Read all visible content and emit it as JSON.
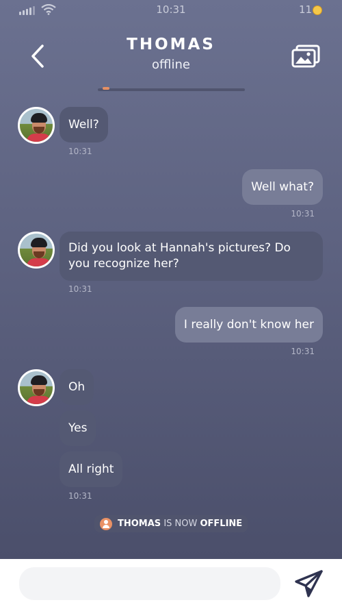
{
  "status_bar": {
    "time": "10:31",
    "battery": "11"
  },
  "header": {
    "name": "THOMAS",
    "status": "offline"
  },
  "messages": [
    {
      "text": "Well?",
      "time": "10:31"
    },
    {
      "text": "Well what?",
      "time": "10:31"
    },
    {
      "text": "Did you look at Hannah's pictures? Do you recognize her?",
      "time": "10:31"
    },
    {
      "text": "I really don't know her",
      "time": "10:31"
    },
    {
      "text": "Oh"
    },
    {
      "text": "Yes"
    },
    {
      "text": "All right",
      "time": "10:31"
    }
  ],
  "notice": {
    "name": "THOMAS",
    "middle": "IS NOW",
    "state": "OFFLINE"
  },
  "input": {
    "placeholder": ""
  },
  "colors": {
    "bubble_in": "#545973",
    "bubble_out": "#787d97",
    "accent": "#e99165",
    "send": "#2f3350"
  },
  "icons": [
    "back-arrow-icon",
    "gallery-icon",
    "user-icon",
    "send-icon"
  ]
}
